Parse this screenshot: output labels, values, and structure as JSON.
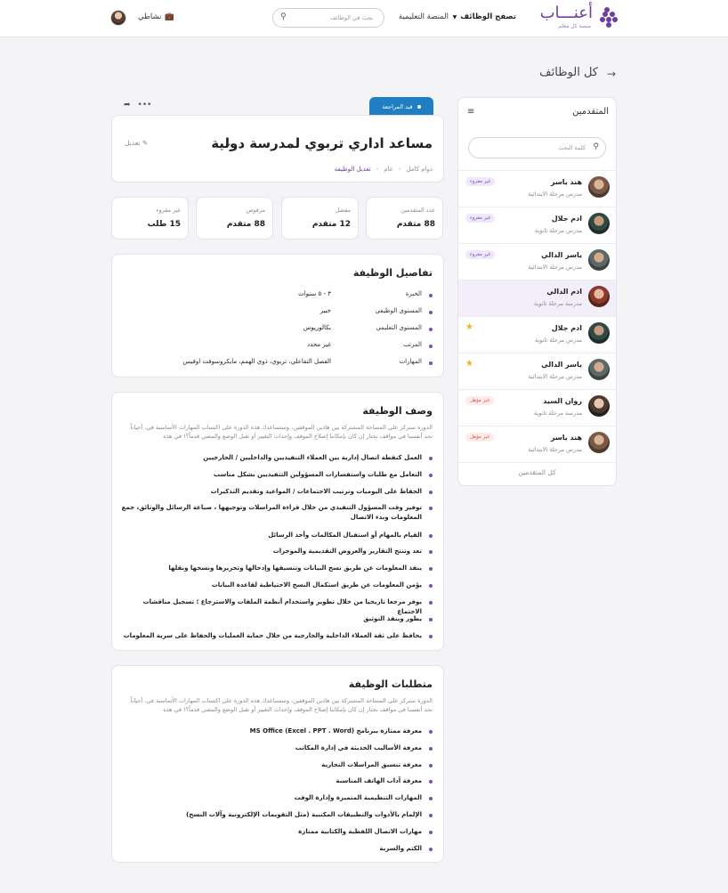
{
  "header": {
    "logo_text": "أعنـــاب",
    "logo_sub": "منصة كل معلم",
    "nav_browse": "تصفح الوظائف",
    "nav_platform": "المنصة التعليمية",
    "search_placeholder": "بحث في الوظائف",
    "my_activity": "نشاطي"
  },
  "page": {
    "title": "كل الوظائف"
  },
  "applicants": {
    "title": "المتقدمين",
    "search_placeholder": "كلمة البحث",
    "all_label": "كل المتقدمين",
    "items": [
      {
        "name": "هند ياسر",
        "sub": "مدرس مرحلة الابتدائية",
        "badge": "غير مقروء"
      },
      {
        "name": "ادم جلال",
        "sub": "مدرس مرحلة ثانوية",
        "badge": "غير مقروء"
      },
      {
        "name": "ياسر الدالي",
        "sub": "مدرس مرحلة الابتدائية",
        "badge": "غير مقروء"
      },
      {
        "name": "ادم الدالي",
        "sub": "مدرسة مرحلة ثانوية",
        "badge": ""
      },
      {
        "name": "ادم جلال",
        "sub": "مدرس مرحلة ثانوية",
        "badge": ""
      },
      {
        "name": "ياسر الدالي",
        "sub": "مدرس مرحلة الابتدائية",
        "badge": ""
      },
      {
        "name": "روان السيد",
        "sub": "مدرسة مرحلة ثانوية",
        "badge": "غير مؤهل"
      },
      {
        "name": "هند ياسر",
        "sub": "مدرس مرحلة الابتدائية",
        "badge": "غير مؤهل"
      }
    ]
  },
  "job": {
    "status": "قيد المراجعة",
    "title": "مساعد اداري تربوي لمدرسة دولية",
    "edit_label": "تعديل",
    "meta_type": "دوام كامل",
    "meta_scope": "عام",
    "meta_edit_link": "تعديل الوظيفة",
    "sep": "-"
  },
  "stats": [
    {
      "label": "عدد المتقدمين",
      "value": "88 متقدم"
    },
    {
      "label": "مفضل",
      "value": "12 متقدم"
    },
    {
      "label": "مرفوض",
      "value": "88 متقدم"
    },
    {
      "label": "غير مقروء",
      "value": "15 طلب"
    }
  ],
  "details": {
    "title": "تفاصيل الوظيفة",
    "rows": [
      {
        "k": "الخبرة",
        "v": "٣ - ٥ سنوات"
      },
      {
        "k": "المستوى الوظيفي",
        "v": "خبير"
      },
      {
        "k": "المستوى التعليمي",
        "v": "بكالوريوس"
      },
      {
        "k": "المرتب",
        "v": "غير محدد"
      },
      {
        "k": "المهارات",
        "v": "الفصل التفاعلي، تربوي، ذوي الهمم، مايكروسوفت اوفيس"
      }
    ]
  },
  "description": {
    "title": "وصف الوظيفة",
    "intro": "الدورة ستركز على المساحة المشتركة بين هاذين الموقفين، وستساعدك هذه الدورة على اكتساب المهارات الأساسية في، أحياناً نجد أنفسنا في مواقف نحتار إن كان بإمكاننا إصلاح الموقف وإحداث التغيير أو تقبل الوضع والمضي قدماً؟! في هذه",
    "items": [
      "العمل كنقطة اتصال إدارية بين العملاء التنفيذيين والداخليين / الخارجيين",
      "التعامل مع طلبات واستفسارات المسؤولين التنفيذيين بشكل مناسب",
      "الحفاظ على اليوميات وترتيب الاجتماعات / المواعيد وتقديم التذكيرات",
      "توفير وقت المسؤول التنفيذي من خلال قراءة المراسلات وتوجيهها ، صياغة الرسائل والوثائق، جمع المعلومات وبدء الاتصال",
      "القيام بالمهام أو استقبال المكالمات وأخذ الرسائل",
      "تعد وتنتج التقارير والعروض التقديمية والموجزات",
      "ينفذ المعلومات عن طريق نسخ البيانات وتنسيقها وإدخالها وتحريرها ونسخها ونقلها",
      "يؤمن المعلومات عن طريق استكمال النسخ الاحتياطية لقاعدة البيانات",
      "يوفر مرجعا تاريخيا من خلال تطوير واستخدام أنظمة الملفات والاسترجاع ؛ تسجيل مناقشات الاجتماع",
      "يطور وينفذ التوثيق",
      "يحافظ على ثقة العملاء الداخلية والخارجية من خلال حماية العمليات والحفاظ على سرية المعلومات"
    ]
  },
  "requirements": {
    "title": "متطلبات الوظيفة",
    "intro": "الدورة ستركز على المساحة المشتركة بين هاذين الموقفين، وستساعدك هذه الدورة على اكتساب المهارات الأساسية في، أحياناً نجد أنفسنا في مواقف نحتار إن كان بإمكاننا إصلاح الموقف وإحداث التغيير أو تقبل الوضع والمضي قدماً؟! في هذه",
    "items": [
      "معرفة ممتازة ببرنامج (MS Office (Excel . PPT . Word",
      "معرفة الأساليب الحديثة في إدارة المكاتب",
      "معرفة تنسيق المراسلات التجارية",
      "معرفة آداب الهاتف المناسبة",
      "المهارات التنظيمية المتميزة وإدارة الوقت",
      "الإلمام بالأدوات والتطبيقات المكتبية (مثل التقويمات الإلكترونية وآلات النسخ)",
      "مهارات الاتصال اللفظية والكتابية ممتازة",
      "الكتم والسرية"
    ]
  },
  "colors": {
    "accent": "#6b3fa0",
    "status_tab": "#1e7fc4",
    "star": "#f2b01e"
  }
}
